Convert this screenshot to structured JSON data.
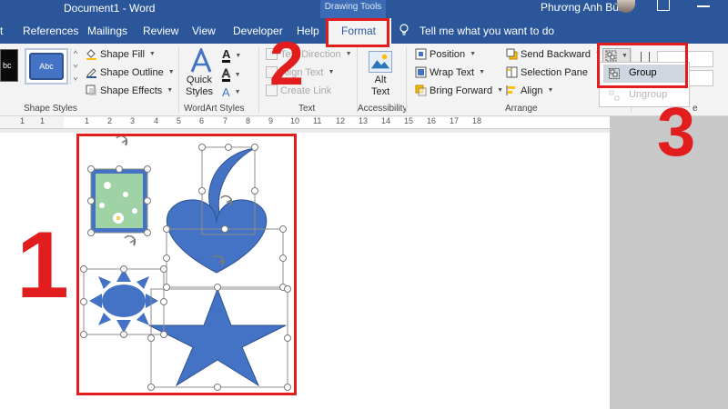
{
  "window": {
    "doc_title": "Document1 - Word",
    "contextual_tools": "Drawing Tools",
    "user_name": "Phương Anh Bùi"
  },
  "tabs": [
    "t",
    "References",
    "Mailings",
    "Review",
    "View",
    "Developer",
    "Help"
  ],
  "active_tab": "Format",
  "tell_me": "Tell me what you want to do",
  "ribbon": {
    "shape_styles": {
      "label": "Shape Styles",
      "preset_dark": "bc",
      "preset_blue": "Abc",
      "shape_fill": "Shape Fill",
      "shape_outline": "Shape Outline",
      "shape_effects": "Shape Effects"
    },
    "wordart": {
      "label": "WordArt Styles",
      "quick_styles_line1": "Quick",
      "quick_styles_line2": "Styles"
    },
    "text": {
      "label": "Text",
      "text_direction": "Text Direction",
      "align_text": "Align Text",
      "create_link": "Create Link"
    },
    "accessibility": {
      "label": "Accessibility",
      "alt_line1": "Alt",
      "alt_line2": "Text"
    },
    "arrange": {
      "label": "Arrange",
      "position": "Position",
      "wrap_text": "Wrap Text",
      "bring_forward": "Bring Forward",
      "send_backward": "Send Backward",
      "selection_pane": "Selection Pane",
      "align": "Align"
    },
    "group_menu": {
      "group": "Group",
      "ungroup": "Ungroup"
    },
    "size_label": "e"
  },
  "ruler_numbers": [
    "1",
    "2",
    "3",
    "4",
    "5",
    "6",
    "7",
    "8",
    "9",
    "10",
    "11",
    "12",
    "13",
    "14",
    "15",
    "16",
    "17",
    "18"
  ],
  "callouts": {
    "one": "1",
    "two": "2",
    "three": "3"
  },
  "colors": {
    "word_blue": "#2b579a",
    "shape_blue": "#4472c4",
    "callout_red": "#e21d1d"
  },
  "icons": [
    "lightbulb-icon",
    "shape-fill-icon",
    "shape-outline-icon",
    "shape-effects-icon",
    "wordart-a-icon",
    "alt-text-icon",
    "position-icon",
    "wrap-text-icon",
    "bring-forward-icon",
    "send-backward-icon",
    "selection-pane-icon",
    "align-icon",
    "group-icon",
    "rotate-handle-icon"
  ]
}
